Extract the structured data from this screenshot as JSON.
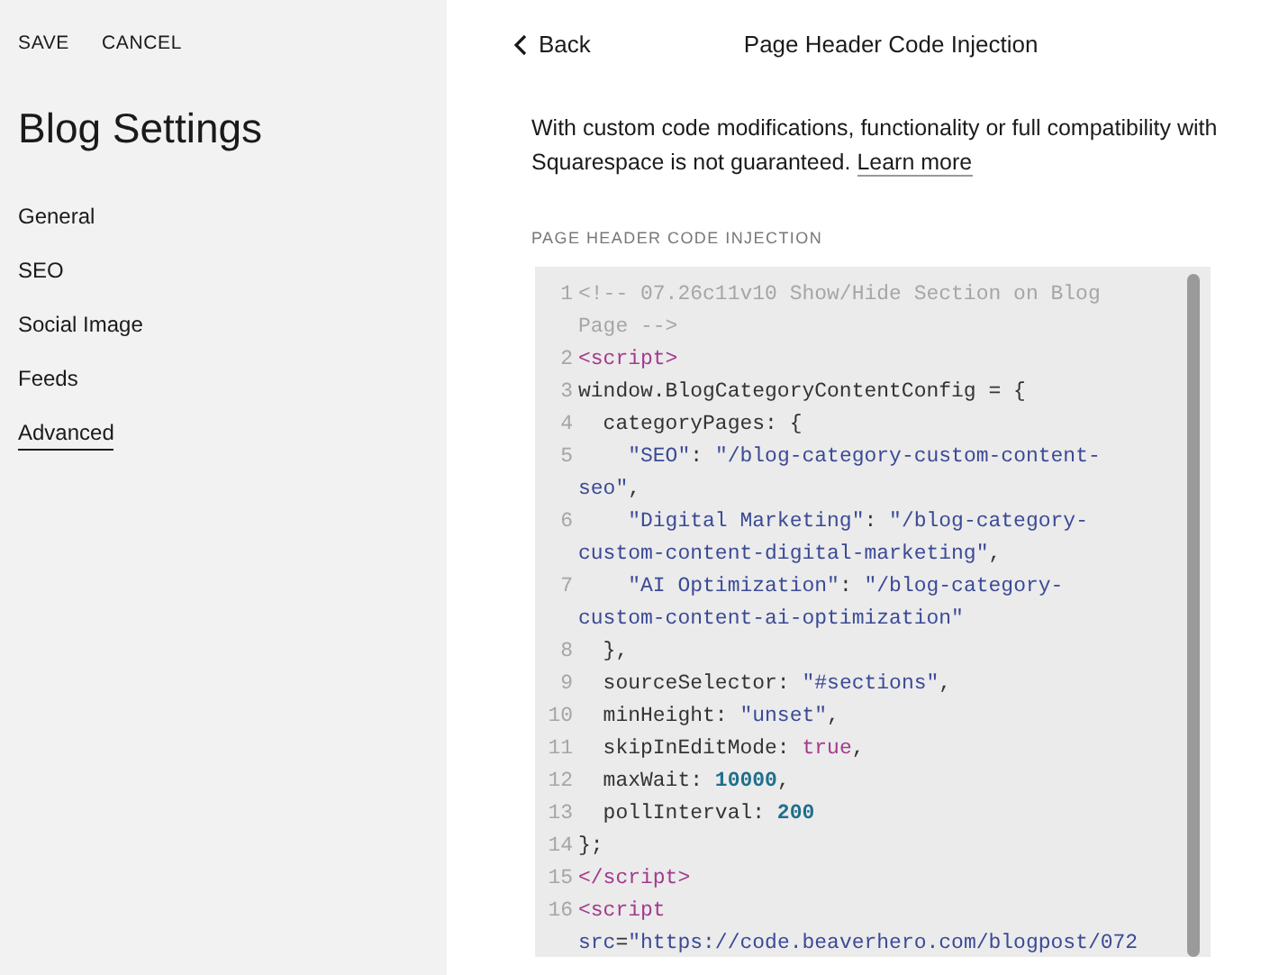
{
  "sidebar": {
    "actions": [
      "SAVE",
      "CANCEL"
    ],
    "title": "Blog Settings",
    "items": [
      {
        "label": "General",
        "selected": false
      },
      {
        "label": "SEO",
        "selected": false
      },
      {
        "label": "Social Image",
        "selected": false
      },
      {
        "label": "Feeds",
        "selected": false
      },
      {
        "label": "Advanced",
        "selected": true
      }
    ]
  },
  "panel": {
    "back": "Back",
    "title": "Page Header Code Injection",
    "notice": "With custom code modifications, functionality or full compatibility with Squarespace is not guaranteed.",
    "notice_link": "Learn more",
    "field_label": "PAGE HEADER CODE INJECTION",
    "code": [
      {
        "number": "1",
        "tokens": [
          {
            "kind": "comment",
            "text": "<!-- 07.26c11v10 Show/Hide Section on Blog"
          },
          {
            "kind": "comment",
            "text": "Page -->",
            "new_row": true
          }
        ]
      },
      {
        "number": "2",
        "tokens": [
          {
            "kind": "tag",
            "text": "<script>"
          }
        ]
      },
      {
        "number": "3",
        "tokens": [
          {
            "kind": "plain",
            "text": "window.BlogCategoryContentConfig = {"
          }
        ]
      },
      {
        "number": "4",
        "tokens": [
          {
            "kind": "plain",
            "text": "  categoryPages: {"
          }
        ]
      },
      {
        "number": "5",
        "tokens": [
          {
            "kind": "string",
            "text": "    \"SEO\""
          },
          {
            "kind": "plain",
            "text": ": "
          },
          {
            "kind": "string",
            "text": "\"/blog-category-custom-content-"
          },
          {
            "kind": "string",
            "text": "seo\"",
            "new_row": true
          },
          {
            "kind": "plain",
            "text": ","
          }
        ]
      },
      {
        "number": "6",
        "tokens": [
          {
            "kind": "string",
            "text": "    \"Digital Marketing\""
          },
          {
            "kind": "plain",
            "text": ": "
          },
          {
            "kind": "string",
            "text": "\"/blog-category-"
          },
          {
            "kind": "string",
            "text": "custom-content-digital-marketing\"",
            "new_row": true
          },
          {
            "kind": "plain",
            "text": ","
          }
        ]
      },
      {
        "number": "7",
        "tokens": [
          {
            "kind": "string",
            "text": "    \"AI Optimization\""
          },
          {
            "kind": "plain",
            "text": ": "
          },
          {
            "kind": "string",
            "text": "\"/blog-category-"
          },
          {
            "kind": "string",
            "text": "custom-content-ai-optimization\"",
            "new_row": true
          }
        ]
      },
      {
        "number": "8",
        "tokens": [
          {
            "kind": "plain",
            "text": "  },"
          }
        ]
      },
      {
        "number": "9",
        "tokens": [
          {
            "kind": "plain",
            "text": "  sourceSelector: "
          },
          {
            "kind": "string",
            "text": "\"#sections\""
          },
          {
            "kind": "plain",
            "text": ","
          }
        ]
      },
      {
        "number": "10",
        "tokens": [
          {
            "kind": "plain",
            "text": "  minHeight: "
          },
          {
            "kind": "string",
            "text": "\"unset\""
          },
          {
            "kind": "plain",
            "text": ","
          }
        ]
      },
      {
        "number": "11",
        "tokens": [
          {
            "kind": "plain",
            "text": "  skipInEditMode: "
          },
          {
            "kind": "keyword",
            "text": "true"
          },
          {
            "kind": "plain",
            "text": ","
          }
        ]
      },
      {
        "number": "12",
        "tokens": [
          {
            "kind": "plain",
            "text": "  maxWait: "
          },
          {
            "kind": "number",
            "text": "10000"
          },
          {
            "kind": "plain",
            "text": ","
          }
        ]
      },
      {
        "number": "13",
        "tokens": [
          {
            "kind": "plain",
            "text": "  pollInterval: "
          },
          {
            "kind": "number",
            "text": "200"
          }
        ]
      },
      {
        "number": "14",
        "tokens": [
          {
            "kind": "plain",
            "text": "};"
          }
        ]
      },
      {
        "number": "15",
        "tokens": [
          {
            "kind": "tag",
            "text": "</script>"
          }
        ]
      },
      {
        "number": "16",
        "tokens": [
          {
            "kind": "tag",
            "text": "<script"
          },
          {
            "kind": "attr",
            "text": "src",
            "new_row": true
          },
          {
            "kind": "plain",
            "text": "="
          },
          {
            "kind": "string",
            "text": "\"https://code.beaverhero.com/blogpost/072"
          }
        ]
      }
    ]
  }
}
